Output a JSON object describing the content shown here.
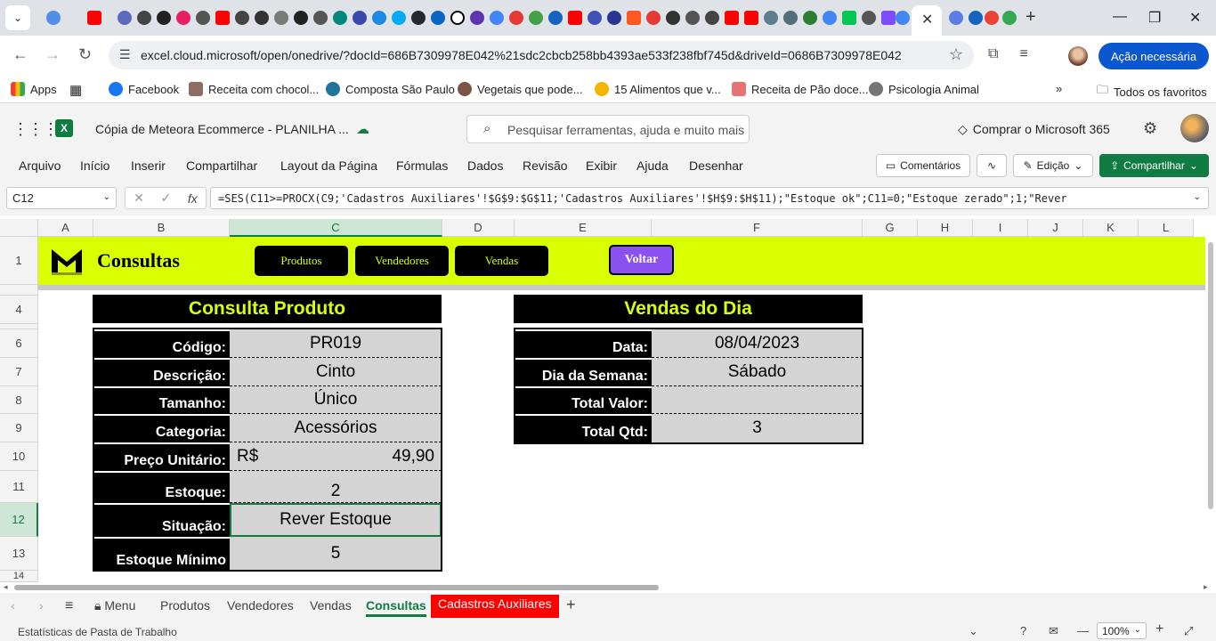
{
  "browser": {
    "url": "excel.cloud.microsoft/open/onedrive/?docId=686B7309978E042%21sdc2cbcb258bb4393ae533f238fbf745d&driveId=0686B7309978E042",
    "action_button": "Ação necessária",
    "bookmarks": [
      {
        "label": "Apps",
        "color": "#4285f4"
      },
      {
        "label": "Facebook",
        "color": "#1877f2"
      },
      {
        "label": "Receita com chocol...",
        "color": "#8d6e63"
      },
      {
        "label": "Composta São Paulo",
        "color": "#21759b"
      },
      {
        "label": "Vegetais que pode...",
        "color": "#795548"
      },
      {
        "label": "15 Alimentos que v...",
        "color": "#f4b400"
      },
      {
        "label": "Receita de Pão doce...",
        "color": "#e57373"
      },
      {
        "label": "Psicologia Animal",
        "color": "#757575"
      }
    ],
    "all_favorites": "Todos os favoritos"
  },
  "excel": {
    "doc_title": "Cópia de Meteora Ecommerce - PLANILHA ...",
    "search_placeholder": "Pesquisar ferramentas, ajuda e muito mais (A",
    "buy_label": "Comprar o Microsoft 365",
    "ribbon_tabs": [
      "Arquivo",
      "Início",
      "Inserir",
      "Compartilhar",
      "Layout da Página",
      "Fórmulas",
      "Dados",
      "Revisão",
      "Exibir",
      "Ajuda",
      "Desenhar"
    ],
    "comments_label": "Comentários",
    "editing_label": "Edição",
    "share_label": "Compartilhar",
    "name_box": "C12",
    "formula": "=SES(C11>=PROCX(C9;'Cadastros Auxiliares'!$G$9:$G$11;'Cadastros Auxiliares'!$H$9:$H$11);\"Estoque ok\";C11=0;\"Estoque zerado\";1;\"Rever",
    "columns": [
      "A",
      "B",
      "C",
      "D",
      "E",
      "F",
      "G",
      "H",
      "I",
      "J",
      "K",
      "L"
    ],
    "rows": [
      "1",
      "4",
      "6",
      "7",
      "8",
      "9",
      "10",
      "11",
      "12",
      "13",
      "14"
    ],
    "accent_green": "#107c41"
  },
  "sheet": {
    "banner": {
      "title": "Consultas",
      "buttons": [
        "Produtos",
        "Vendedores",
        "Vendas"
      ],
      "back_button": "Voltar",
      "color": "#d9ff00"
    },
    "consulta_produto": {
      "title": "Consulta Produto",
      "fields": [
        {
          "label": "Código:",
          "value": "PR019"
        },
        {
          "label": "Descrição:",
          "value": "Cinto"
        },
        {
          "label": "Tamanho:",
          "value": "Único"
        },
        {
          "label": "Categoria:",
          "value": "Acessórios"
        },
        {
          "label": "Preço Unitário:",
          "currency": "R$",
          "value": "49,90"
        },
        {
          "label": "Estoque:",
          "value": "2"
        },
        {
          "label": "Situação:",
          "value": "Rever Estoque"
        },
        {
          "label": "Estoque Mínimo",
          "value": "5"
        }
      ]
    },
    "vendas_do_dia": {
      "title": "Vendas do Dia",
      "fields": [
        {
          "label": "Data:",
          "value": "08/04/2023"
        },
        {
          "label": "Dia da Semana:",
          "value": "Sábado"
        },
        {
          "label": "Total Valor:",
          "value": ""
        },
        {
          "label": "Total Qtd:",
          "value": "3"
        }
      ]
    }
  },
  "sheet_tabs": {
    "menu": "Menu",
    "tabs": [
      "Produtos",
      "Vendedores",
      "Vendas",
      "Consultas",
      "Cadastros Auxiliares"
    ],
    "active": "Consultas"
  },
  "status": {
    "text": "Estatísticas de Pasta de Trabalho",
    "zoom": "100%"
  }
}
